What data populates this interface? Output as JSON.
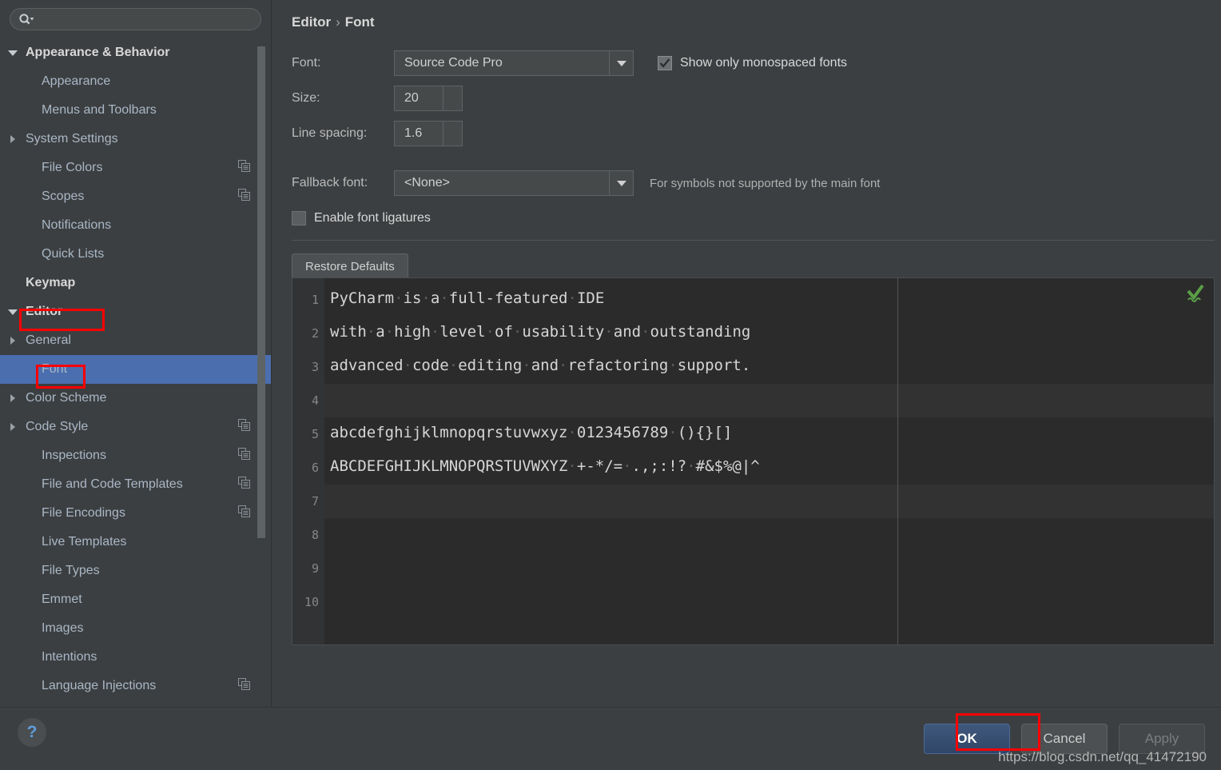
{
  "search": {
    "placeholder": "",
    "value": "",
    "icon": "search-icon"
  },
  "sidebar": {
    "items": [
      {
        "label": "Appearance & Behavior",
        "level": 0,
        "twisty": "open",
        "bold": true,
        "copy": false
      },
      {
        "label": "Appearance",
        "level": 1,
        "twisty": "none",
        "bold": false,
        "copy": false
      },
      {
        "label": "Menus and Toolbars",
        "level": 1,
        "twisty": "none",
        "bold": false,
        "copy": false
      },
      {
        "label": "System Settings",
        "level": 1,
        "twisty": "closed",
        "bold": false,
        "copy": false
      },
      {
        "label": "File Colors",
        "level": 1,
        "twisty": "none",
        "bold": false,
        "copy": true
      },
      {
        "label": "Scopes",
        "level": 1,
        "twisty": "none",
        "bold": false,
        "copy": true
      },
      {
        "label": "Notifications",
        "level": 1,
        "twisty": "none",
        "bold": false,
        "copy": false
      },
      {
        "label": "Quick Lists",
        "level": 1,
        "twisty": "none",
        "bold": false,
        "copy": false
      },
      {
        "label": "Keymap",
        "level": 0,
        "twisty": "none",
        "bold": true,
        "copy": false
      },
      {
        "label": "Editor",
        "level": 0,
        "twisty": "open",
        "bold": true,
        "copy": false
      },
      {
        "label": "General",
        "level": 1,
        "twisty": "closed",
        "bold": false,
        "copy": false
      },
      {
        "label": "Font",
        "level": 1,
        "twisty": "none",
        "bold": false,
        "copy": false,
        "selected": true
      },
      {
        "label": "Color Scheme",
        "level": 1,
        "twisty": "closed",
        "bold": false,
        "copy": false
      },
      {
        "label": "Code Style",
        "level": 1,
        "twisty": "closed",
        "bold": false,
        "copy": true
      },
      {
        "label": "Inspections",
        "level": 1,
        "twisty": "none",
        "bold": false,
        "copy": true
      },
      {
        "label": "File and Code Templates",
        "level": 1,
        "twisty": "none",
        "bold": false,
        "copy": true
      },
      {
        "label": "File Encodings",
        "level": 1,
        "twisty": "none",
        "bold": false,
        "copy": true
      },
      {
        "label": "Live Templates",
        "level": 1,
        "twisty": "none",
        "bold": false,
        "copy": false
      },
      {
        "label": "File Types",
        "level": 1,
        "twisty": "none",
        "bold": false,
        "copy": false
      },
      {
        "label": "Emmet",
        "level": 1,
        "twisty": "none",
        "bold": false,
        "copy": false
      },
      {
        "label": "Images",
        "level": 1,
        "twisty": "none",
        "bold": false,
        "copy": false
      },
      {
        "label": "Intentions",
        "level": 1,
        "twisty": "none",
        "bold": false,
        "copy": false
      },
      {
        "label": "Language Injections",
        "level": 1,
        "twisty": "none",
        "bold": false,
        "copy": true
      }
    ]
  },
  "breadcrumb": {
    "parent": "Editor",
    "separator": "›",
    "current": "Font"
  },
  "form": {
    "font_label": "Font:",
    "font_value": "Source Code Pro",
    "monospaced_label": "Show only monospaced fonts",
    "monospaced_checked": true,
    "size_label": "Size:",
    "size_value": "20",
    "line_spacing_label": "Line spacing:",
    "line_spacing_value": "1.6",
    "fallback_label": "Fallback font:",
    "fallback_value": "<None>",
    "fallback_hint": "For symbols not supported by the main font",
    "ligatures_label": "Enable font ligatures",
    "ligatures_checked": false,
    "restore_defaults": "Restore Defaults"
  },
  "preview": {
    "lines": [
      {
        "num": "1",
        "text": "PyCharm is a full-featured IDE"
      },
      {
        "num": "2",
        "text": "with a high level of usability and outstanding"
      },
      {
        "num": "3",
        "text": "advanced code editing and refactoring support."
      },
      {
        "num": "4",
        "text": ""
      },
      {
        "num": "5",
        "text": "abcdefghijklmnopqrstuvwxyz 0123456789 (){}[]"
      },
      {
        "num": "6",
        "text": "ABCDEFGHIJKLMNOPQRSTUVWXYZ +-*/= .,;:!? #&$%@|^"
      },
      {
        "num": "7",
        "text": ""
      },
      {
        "num": "8",
        "text": ""
      },
      {
        "num": "9",
        "text": ""
      },
      {
        "num": "10",
        "text": ""
      }
    ],
    "inspection_icon": "inspection-ok-icon"
  },
  "bottom": {
    "help": "?",
    "ok": "OK",
    "cancel": "Cancel",
    "apply": "Apply",
    "watermark": "https://blog.csdn.net/qq_41472190"
  },
  "colors": {
    "accent_selection": "#4b6eaf",
    "panel_bg": "#3c3f41",
    "editor_bg": "#2b2b2b",
    "annotation_red": "#ff0000",
    "ok_blue": "#385176",
    "help_blue": "#5f9ddb",
    "inspection_green": "#5a9e46"
  }
}
